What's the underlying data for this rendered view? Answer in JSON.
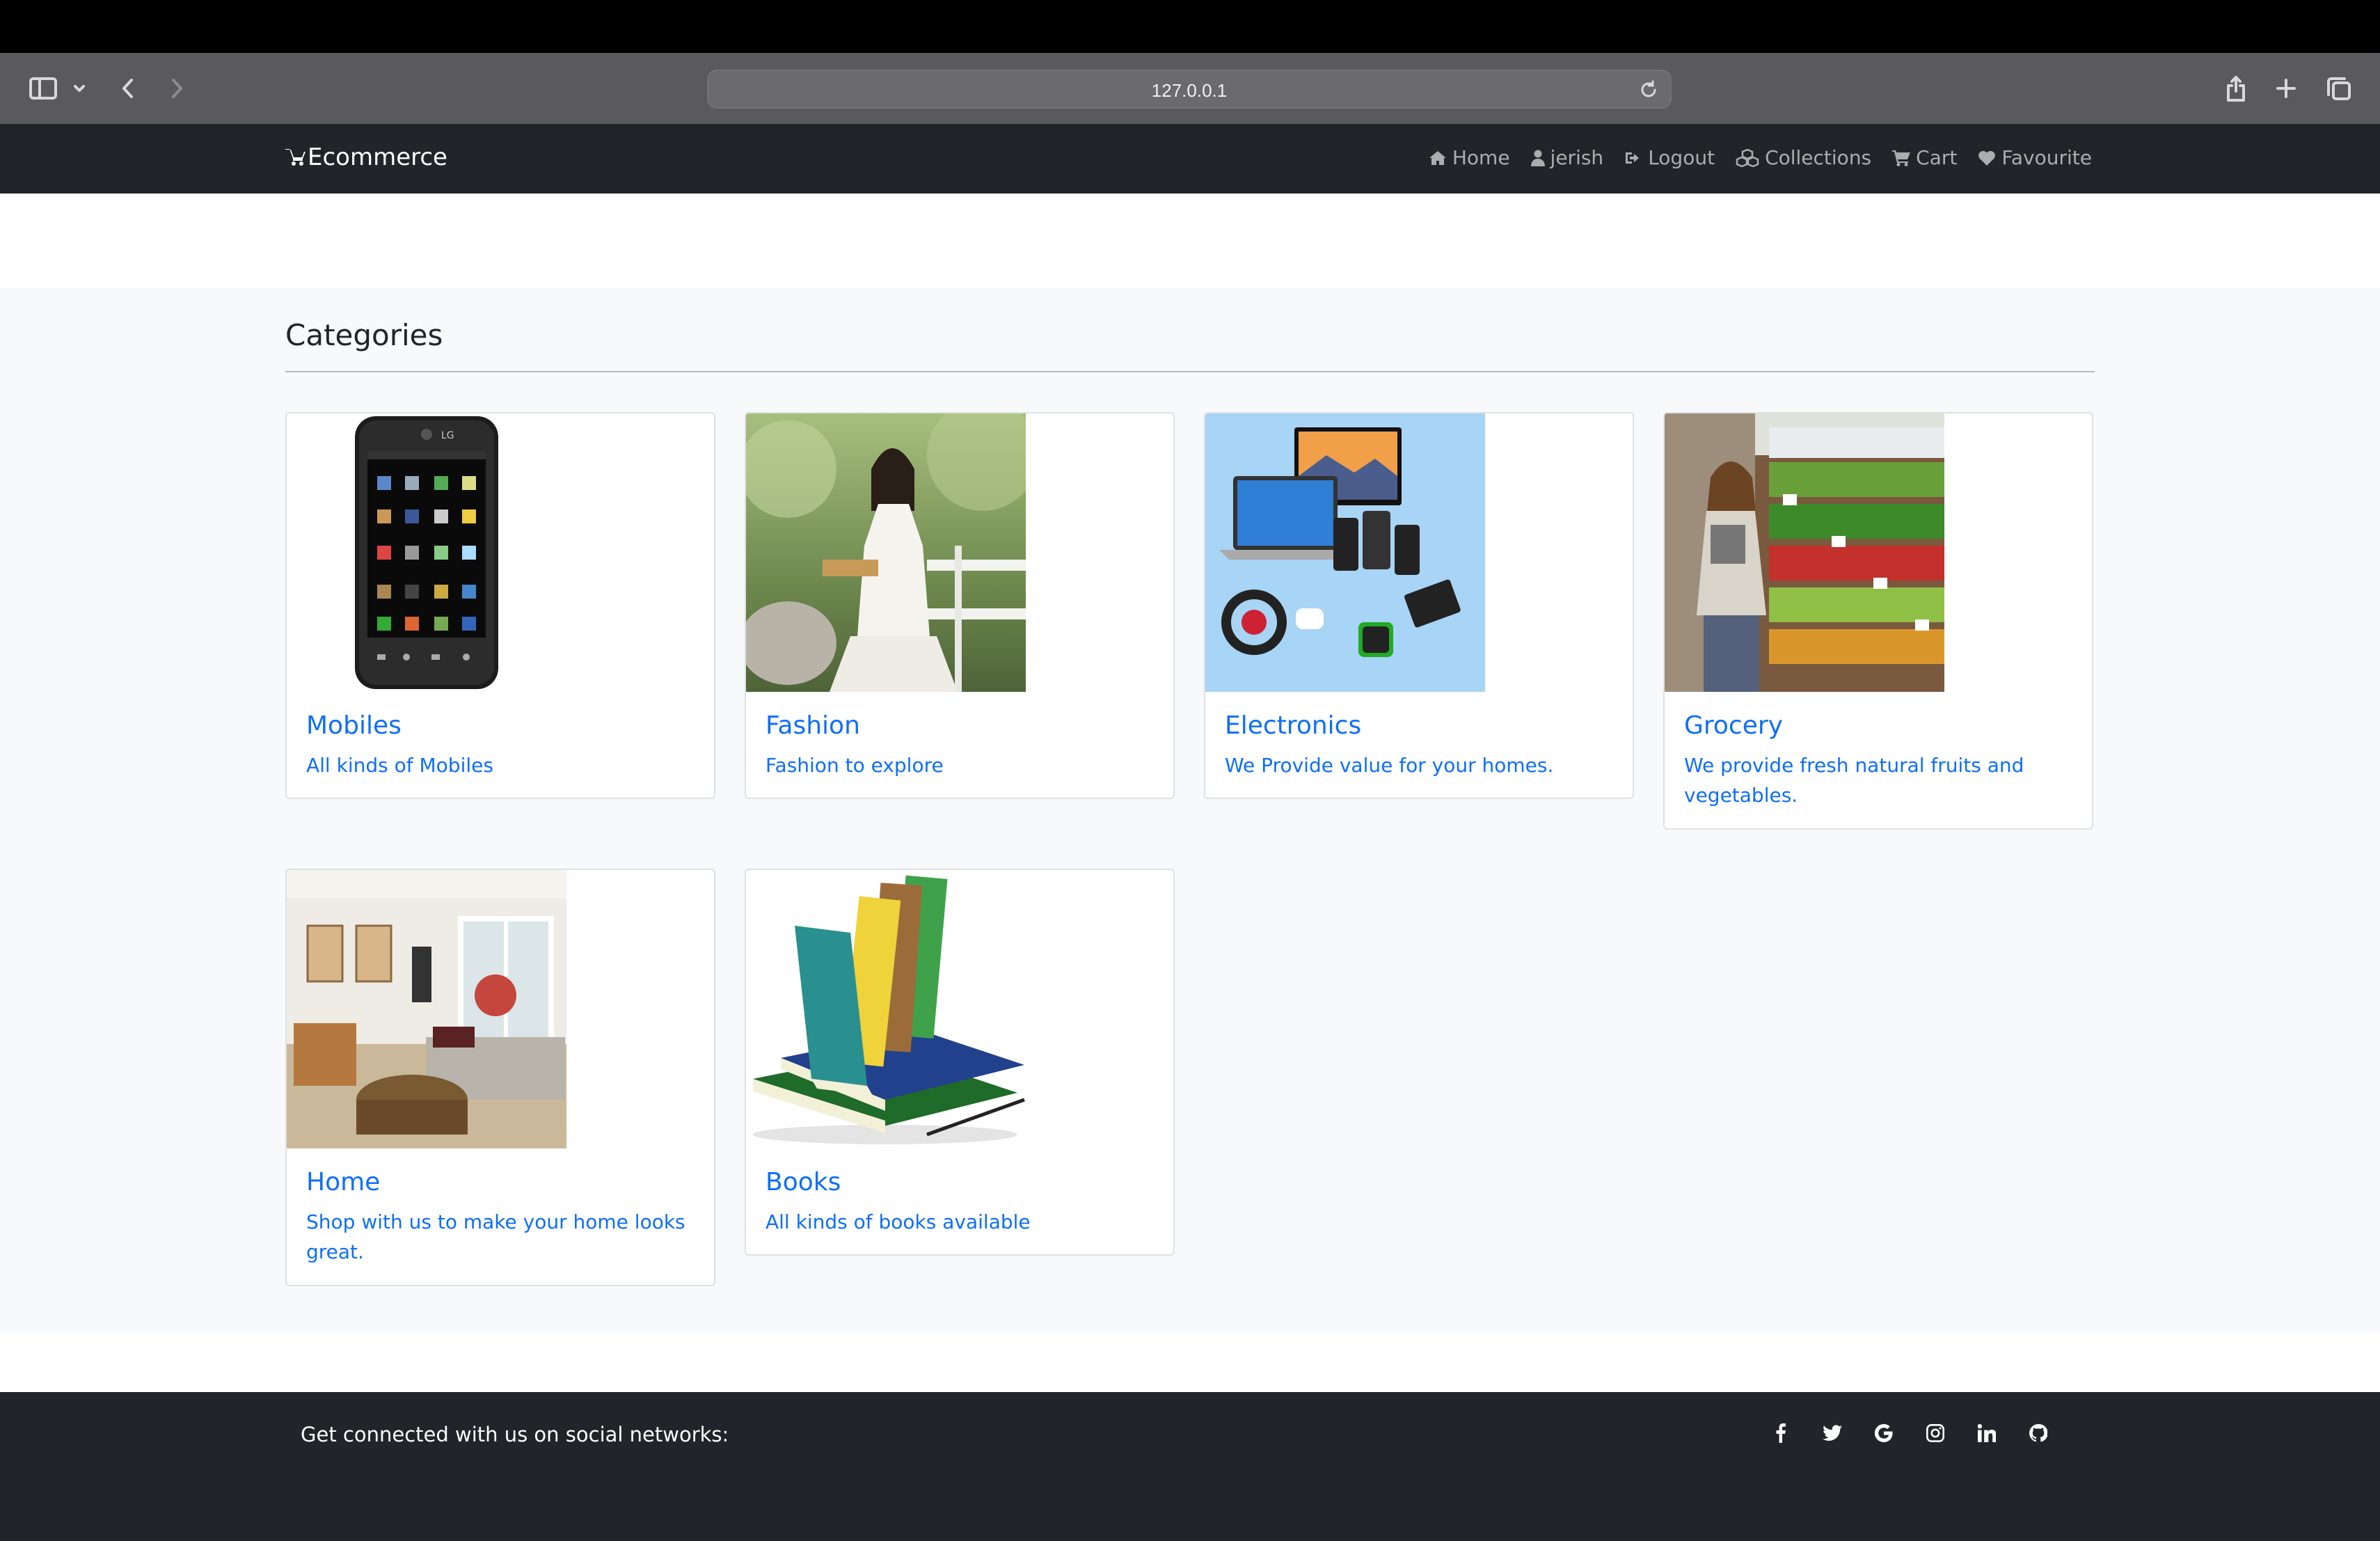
{
  "browser": {
    "url": "127.0.0.1"
  },
  "navbar": {
    "brand": "Ecommerce",
    "links": [
      {
        "label": "Home",
        "icon": "home-icon"
      },
      {
        "label": "jerish",
        "icon": "user-icon"
      },
      {
        "label": "Logout",
        "icon": "sign-out-icon"
      },
      {
        "label": "Collections",
        "icon": "cubes-icon"
      },
      {
        "label": "Cart",
        "icon": "cart-icon"
      },
      {
        "label": "Favourite",
        "icon": "heart-icon"
      }
    ]
  },
  "categories": {
    "heading": "Categories",
    "items": [
      {
        "title": "Mobiles",
        "description": "All kinds of Mobiles",
        "image": "mobile-phone-image"
      },
      {
        "title": "Fashion",
        "description": "Fashion to explore",
        "image": "woman-white-dress-image"
      },
      {
        "title": "Electronics",
        "description": "We Provide value for your homes.",
        "image": "electronics-devices-image"
      },
      {
        "title": "Grocery",
        "description": "We provide fresh natural fruits and vegetables.",
        "image": "grocery-shelves-image"
      },
      {
        "title": "Home",
        "description": "Shop with us to make your home looks great.",
        "image": "living-room-image"
      },
      {
        "title": "Books",
        "description": "All kinds of books available",
        "image": "stack-of-books-image"
      }
    ]
  },
  "footer": {
    "text": "Get connected with us on social networks:",
    "socials": [
      "facebook-icon",
      "twitter-icon",
      "google-icon",
      "instagram-icon",
      "linkedin-icon",
      "github-icon"
    ]
  },
  "colors": {
    "navbar": "#212529",
    "link": "#0d6efd",
    "section_bg": "#f8f9fa"
  }
}
